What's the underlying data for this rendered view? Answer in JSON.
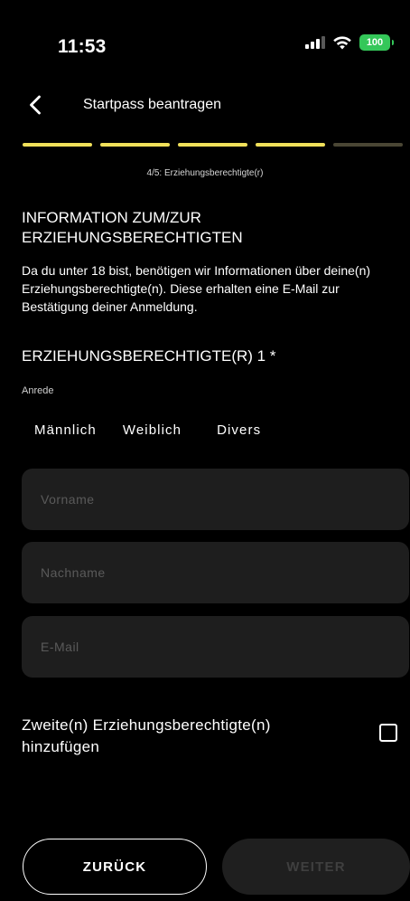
{
  "status_bar": {
    "time": "11:53",
    "battery": "100",
    "icons": [
      "signal-icon",
      "wifi-icon",
      "battery-icon"
    ],
    "battery_color": "#34c759"
  },
  "header": {
    "title": "Startpass beantragen",
    "back_icon": "chevron-left-icon"
  },
  "progress": {
    "current": 4,
    "total": 5,
    "label": "4/5: Erziehungsberechtigte(r)",
    "active_color": "#f0e05a",
    "inactive_color": "#4a4634"
  },
  "section": {
    "heading": "INFORMATION ZUM/ZUR ERZIEHUNGSBERECHTIGTEN",
    "intro": "Da du unter 18 bist, benötigen wir Informationen über deine(n) Erziehungsberechtigte(n). Diese erhalten eine E-Mail zur Bestätigung deiner Anmeldung."
  },
  "guardian": {
    "heading": "ERZIEHUNGSBERECHTIGTE(R) 1 *",
    "salutation_label": "Anrede",
    "salutation_options": [
      "Männlich",
      "Weiblich",
      "Divers"
    ],
    "first_name_placeholder": "Vorname",
    "last_name_placeholder": "Nachname",
    "email_placeholder": "E-Mail"
  },
  "second_guardian": {
    "label": "Zweite(n) Erziehungsberechtigte(n) hinzufügen",
    "checked": false
  },
  "footer": {
    "back_label": "ZURÜCK",
    "next_label": "WEITER"
  }
}
